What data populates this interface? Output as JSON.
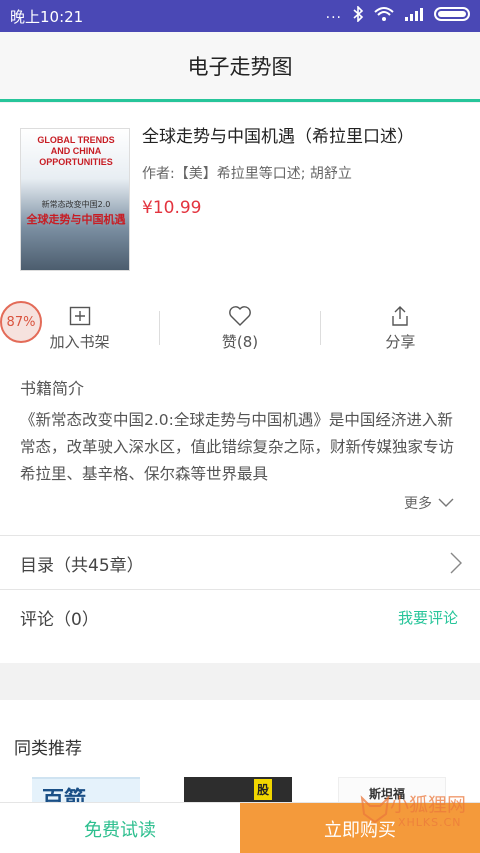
{
  "statusbar": {
    "time": "晚上10:21",
    "dots": "..."
  },
  "header": {
    "title": "电子走势图"
  },
  "book": {
    "title": "全球走势与中国机遇（希拉里口述）",
    "author": "作者:【美】希拉里等口述; 胡舒立",
    "price": "¥10.99",
    "cover": {
      "title_en": "GLOBAL TRENDS AND CHINA OPPORTUNITIES",
      "subtitle_cn": "新常态改变中国2.0",
      "title_cn": "全球走势与中国机遇"
    }
  },
  "badge": {
    "progress_text": "87%"
  },
  "actions": [
    {
      "label": "加入书架",
      "icon": "add-to-shelf-icon"
    },
    {
      "label": "赞(8)",
      "icon": "heart-icon"
    },
    {
      "label": "分享",
      "icon": "share-icon"
    }
  ],
  "intro": {
    "heading": "书籍简介",
    "text": "《新常态改变中国2.0:全球走势与中国机遇》是中国经济进入新常态，改革驶入深水区，值此错综复杂之际，财新传媒独家专访希拉里、基辛格、保尔森等世界最具",
    "more_label": "更多"
  },
  "toc": {
    "label": "目录（共45章）"
  },
  "comments": {
    "label": "评论（0）",
    "action": "我要评论"
  },
  "recommend": {
    "heading": "同类推荐",
    "items": [
      {
        "text": "百箭"
      },
      {
        "text": "股"
      },
      {
        "text": "斯坦福"
      }
    ]
  },
  "bottom": {
    "trial": "免费试读",
    "buy": "立即购买"
  },
  "watermark": {
    "cn": "小狐狸网",
    "en": "XHLKS.CN"
  },
  "colors": {
    "accent": "#27c59a",
    "price": "#e3343f",
    "buy": "#f49a3b",
    "statusbar": "#4a48b5"
  }
}
